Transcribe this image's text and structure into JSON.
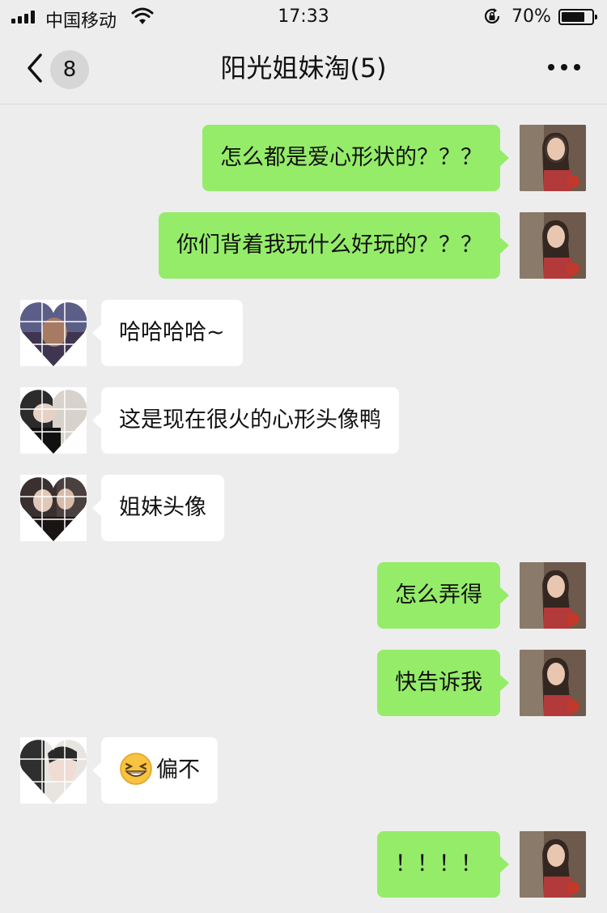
{
  "status_bar": {
    "carrier": "中国移动",
    "time": "17:33",
    "battery_percent": "70%",
    "battery_level": 0.7,
    "icons": [
      "signal-icon",
      "wifi-icon",
      "rotation-lock-icon",
      "battery-icon"
    ]
  },
  "nav": {
    "back_icon": "chevron-left-icon",
    "unread_count": "8",
    "title": "阳光姐妹淘(5)",
    "more_icon": "more-dots-icon"
  },
  "messages": [
    {
      "side": "right",
      "text": "怎么都是爱心形状的？？？"
    },
    {
      "side": "right",
      "text": "你们背着我玩什么好玩的？？？"
    },
    {
      "side": "left",
      "text": "哈哈哈哈~"
    },
    {
      "side": "left",
      "text": "这是现在很火的心形头像鸭"
    },
    {
      "side": "left",
      "text": "姐妹头像"
    },
    {
      "side": "right",
      "text": "怎么弄得"
    },
    {
      "side": "right",
      "text": "快告诉我"
    },
    {
      "side": "left",
      "text": "偏不",
      "emoji": "grinning-squint-emoji"
    },
    {
      "side": "right",
      "text": "！！！！"
    }
  ],
  "colors": {
    "background": "#ededed",
    "outgoing_bubble": "#95ec69",
    "incoming_bubble": "#ffffff",
    "badge": "#d6d6d6"
  }
}
